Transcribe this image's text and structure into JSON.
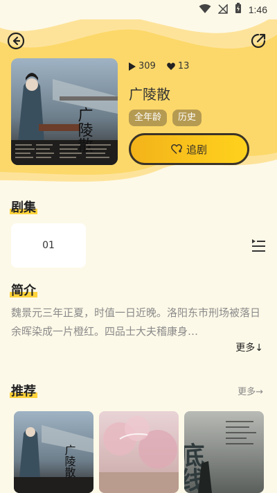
{
  "status_bar": {
    "time": "1:46"
  },
  "drama": {
    "plays": "309",
    "likes": "13",
    "title": "广陵散",
    "cover_art_text": "广陵散",
    "tags": [
      "全年龄",
      "历史"
    ],
    "follow_label": "追剧"
  },
  "episodes": {
    "title": "剧集",
    "items": [
      "01"
    ]
  },
  "intro": {
    "title": "简介",
    "text": "魏景元三年正夏，时值一日近晚。洛阳东市刑场被落日余晖染成一片橙红。四品士大夫稽康身…",
    "more_label": "更多↓"
  },
  "recommend": {
    "title": "推荐",
    "more_label": "更多→",
    "covers": [
      {
        "art_text": "广陵散"
      },
      {
        "art_text": ""
      },
      {
        "art_text": "底线"
      }
    ]
  },
  "colors": {
    "accent": "#ffd21d",
    "tag": "#b59a52",
    "background": "#fdf9e8"
  }
}
